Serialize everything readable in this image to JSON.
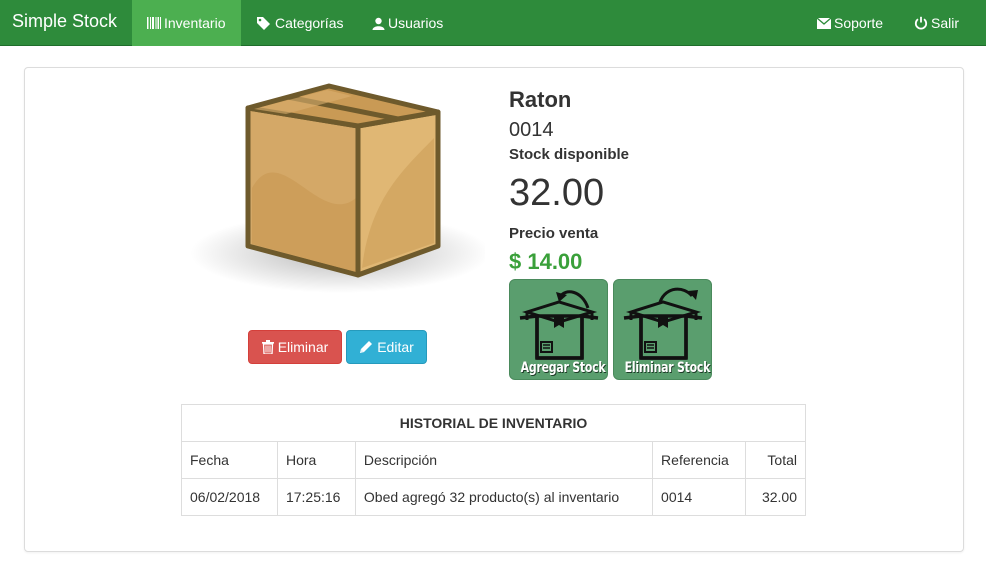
{
  "navbar": {
    "brand": "Simple Stock",
    "items": [
      {
        "label": "Inventario",
        "icon": "barcode-icon"
      },
      {
        "label": "Categorías",
        "icon": "tags-icon"
      },
      {
        "label": "Usuarios",
        "icon": "user-icon"
      }
    ],
    "right_items": [
      {
        "label": "Soporte",
        "icon": "envelope-icon"
      },
      {
        "label": "Salir",
        "icon": "power-icon"
      }
    ],
    "active": "Inventario"
  },
  "product": {
    "name": "Raton",
    "code": "0014",
    "stock_label": "Stock disponible",
    "stock_value": "32.00",
    "price_label": "Precio venta",
    "price_value": "$ 14.00",
    "image_icon": "cardboard-box-icon"
  },
  "actions": {
    "delete_label": "Eliminar",
    "edit_label": "Editar",
    "add_stock_label": "Agregar Stock",
    "remove_stock_label": "Eliminar Stock"
  },
  "history": {
    "title": "HISTORIAL DE INVENTARIO",
    "columns": [
      "Fecha",
      "Hora",
      "Descripción",
      "Referencia",
      "Total"
    ],
    "rows": [
      [
        "06/02/2018",
        "17:25:16",
        "Obed agregó 32 producto(s) al inventario",
        "0014",
        "32.00"
      ]
    ]
  },
  "colors": {
    "navbar": "#2e8b3b",
    "navbar_active": "#4caf50",
    "price": "#3aa03a",
    "danger": "#d9534f",
    "info": "#31b0d5",
    "stock_button": "#5a9e6e"
  }
}
